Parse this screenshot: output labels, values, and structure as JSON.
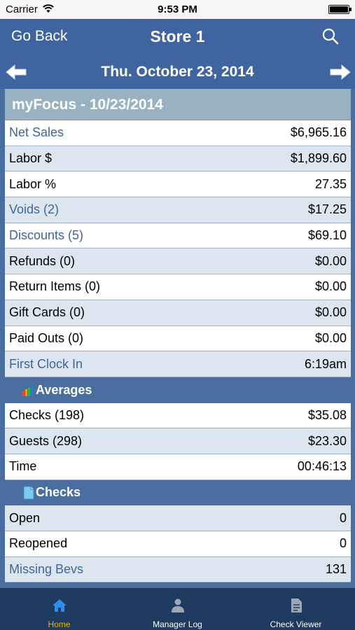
{
  "status_bar": {
    "carrier": "Carrier",
    "time": "9:53 PM"
  },
  "nav": {
    "back_label": "Go Back",
    "title": "Store 1",
    "search_icon": "search-icon"
  },
  "date_bar": {
    "date": "Thu. October 23, 2014",
    "prev_icon": "arrow-left-icon",
    "next_icon": "arrow-right-icon"
  },
  "focus": {
    "header": "myFocus - 10/23/2014",
    "rows": [
      {
        "label": "Net Sales",
        "value": "$6,965.16"
      },
      {
        "label": "Labor $",
        "value": "$1,899.60"
      },
      {
        "label": "Labor %",
        "value": "27.35"
      },
      {
        "label": "Voids (2)",
        "value": "$17.25"
      },
      {
        "label": "Discounts (5)",
        "value": "$69.10"
      },
      {
        "label": "Refunds (0)",
        "value": "$0.00"
      },
      {
        "label": "Return Items (0)",
        "value": "$0.00"
      },
      {
        "label": "Gift Cards (0)",
        "value": "$0.00"
      },
      {
        "label": "Paid Outs (0)",
        "value": "$0.00"
      },
      {
        "label": "First Clock In",
        "value": "6:19am"
      }
    ]
  },
  "averages": {
    "header": "Averages",
    "icon": "bar-chart-icon",
    "rows": [
      {
        "label": "Checks (198)",
        "value": "$35.08"
      },
      {
        "label": "Guests (298)",
        "value": "$23.30"
      },
      {
        "label": "Time",
        "value": "00:46:13"
      }
    ]
  },
  "checks": {
    "header": "Checks",
    "icon": "document-icon",
    "rows": [
      {
        "label": "Open",
        "value": "0"
      },
      {
        "label": "Reopened",
        "value": "0"
      },
      {
        "label": "Missing Bevs",
        "value": "131"
      }
    ]
  },
  "tabs": [
    {
      "label": "Home",
      "icon": "home-icon",
      "active": true
    },
    {
      "label": "Manager Log",
      "icon": "person-icon",
      "active": false
    },
    {
      "label": "Check Viewer",
      "icon": "document-icon",
      "active": false
    }
  ],
  "colors": {
    "nav_bg": "#3f64a0",
    "link_text": "#3f64a0",
    "header_bg": "#98b2c2",
    "row_shade": "#dde6ef",
    "tab_bg": "#1e3a5e",
    "tab_active": "#f0b400"
  }
}
